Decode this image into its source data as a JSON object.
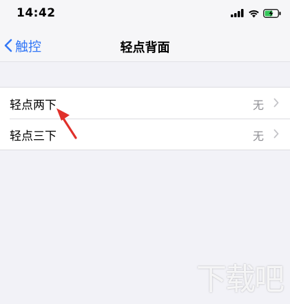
{
  "status_bar": {
    "time": "14:42",
    "icons": [
      "signal-icon",
      "wifi-icon",
      "battery-charging-icon"
    ]
  },
  "nav": {
    "back_label": "触控",
    "title": "轻点背面"
  },
  "settings": [
    {
      "label": "轻点两下",
      "value": "无"
    },
    {
      "label": "轻点三下",
      "value": "无"
    }
  ],
  "annotation": {
    "color": "#e0302a"
  },
  "watermark": "下载吧",
  "colors": {
    "accent": "#3478f6",
    "secondary_text": "#8e8e93",
    "background": "#f2f2f7"
  }
}
